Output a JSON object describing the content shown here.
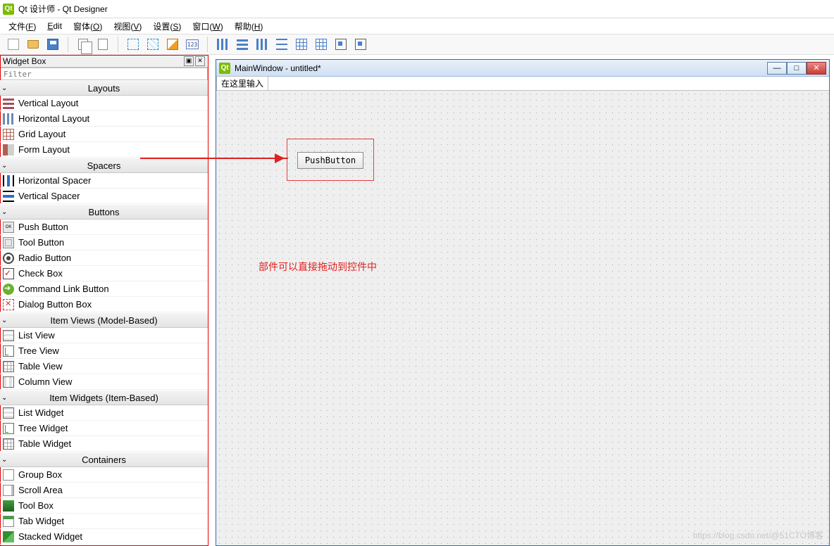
{
  "app": {
    "title": "Qt 设计师 - Qt Designer"
  },
  "menubar": [
    {
      "label": "文件(",
      "key": "F",
      "suffix": ")"
    },
    {
      "label": "",
      "key": "E",
      "suffix": "dit"
    },
    {
      "label": "窗体(",
      "key": "O",
      "suffix": ")"
    },
    {
      "label": "视图(",
      "key": "V",
      "suffix": ")"
    },
    {
      "label": "设置(",
      "key": "S",
      "suffix": ")"
    },
    {
      "label": "窗口(",
      "key": "W",
      "suffix": ")"
    },
    {
      "label": "帮助(",
      "key": "H",
      "suffix": ")"
    }
  ],
  "widgetbox": {
    "title": "Widget Box",
    "filter_placeholder": "Filter",
    "categories": [
      {
        "name": "Layouts",
        "items": [
          "Vertical Layout",
          "Horizontal Layout",
          "Grid Layout",
          "Form Layout"
        ]
      },
      {
        "name": "Spacers",
        "items": [
          "Horizontal Spacer",
          "Vertical Spacer"
        ]
      },
      {
        "name": "Buttons",
        "items": [
          "Push Button",
          "Tool Button",
          "Radio Button",
          "Check Box",
          "Command Link Button",
          "Dialog Button Box"
        ]
      },
      {
        "name": "Item Views (Model-Based)",
        "items": [
          "List View",
          "Tree View",
          "Table View",
          "Column View"
        ]
      },
      {
        "name": "Item Widgets (Item-Based)",
        "items": [
          "List Widget",
          "Tree Widget",
          "Table Widget"
        ]
      },
      {
        "name": "Containers",
        "items": [
          "Group Box",
          "Scroll Area",
          "Tool Box",
          "Tab Widget",
          "Stacked Widget"
        ]
      }
    ]
  },
  "form": {
    "title": "MainWindow - untitled*",
    "menu_hint": "在这里输入",
    "pushbutton_text": "PushButton"
  },
  "annotation": "部件可以直接拖动到控件中",
  "watermark": "https://blog.csdn.net/@51CTO博客"
}
